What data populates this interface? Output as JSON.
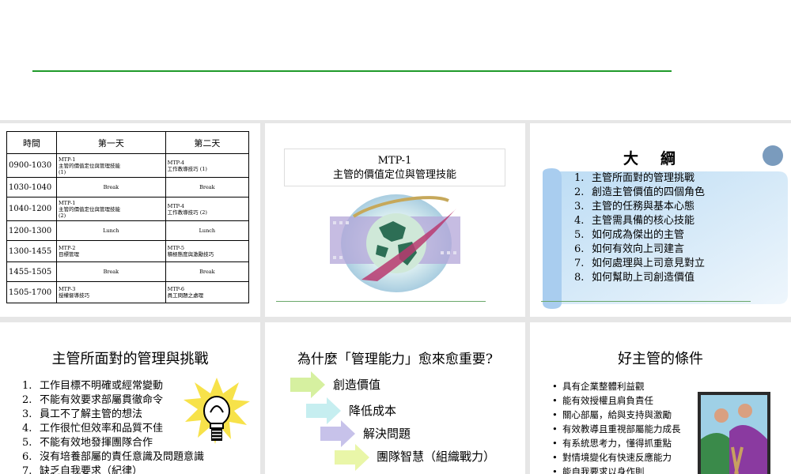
{
  "schedule": {
    "headers": [
      "時間",
      "第一天",
      "第二天"
    ],
    "rows": [
      {
        "time": "0900-1030",
        "day1": "MTP-1\n主管的價值定位與管理技能\n(1)",
        "day2": "MTP-4\n工作教導技巧 (1)"
      },
      {
        "time": "1030-1040",
        "day1": "Break",
        "day2": "Break"
      },
      {
        "time": "1040-1200",
        "day1": "MTP-1\n主管的價值定位與管理技能\n(2)",
        "day2": "MTP-4\n工作教導技巧 (2)"
      },
      {
        "time": "1200-1300",
        "day1": "Lunch",
        "day2": "Lunch"
      },
      {
        "time": "1300-1455",
        "day1": "MTP-2\n目標管理",
        "day2": "MTP-5\n積極態度與激勵技巧"
      },
      {
        "time": "1455-1505",
        "day1": "Break",
        "day2": "Break"
      },
      {
        "time": "1505-1700",
        "day1": "MTP-3\n授權督導技巧",
        "day2": "MTP-6\n員工問題之處理"
      }
    ]
  },
  "title_slide": {
    "line1": "MTP-1",
    "line2": "主管的價值定位與管理技能"
  },
  "outline": {
    "title": "大綱",
    "items": [
      "主管所面對的管理挑戰",
      "創造主管價值的四個角色",
      "主管的任務與基本心態",
      "主管需具備的核心技能",
      "如何成為傑出的主管",
      "如何有效向上司建言",
      "如何處理與上司意見對立",
      "如何幫助上司創造價值"
    ]
  },
  "challenges": {
    "title": "主管所面對的管理與挑戰",
    "items": [
      "工作目標不明確或經常變動",
      "不能有效要求部屬貫徹命令",
      "員工不了解主管的想法",
      "工作很忙但效率和品質不佳",
      "不能有效地發揮團隊合作",
      "沒有培養部屬的責任意識及問題意識",
      "缺乏自我要求（紀律）"
    ]
  },
  "why": {
    "title": "為什麼「管理能力」愈來愈重要?",
    "steps": [
      "創造價值",
      "降低成本",
      "解決問題",
      "團隊智慧（組織戰力）"
    ]
  },
  "good_boss": {
    "title": "好主管的條件",
    "items": [
      "具有企業整體利益觀",
      "能有效授權且肩負責任",
      "關心部屬，給與支持與激勵",
      "有效教導且重視部屬能力成長",
      "有系統思考力，懂得抓重點",
      "對情境變化有快速反應能力",
      "能自我要求以身作則"
    ]
  },
  "colors": {
    "rule_green": "#1f9a2a",
    "scroll_blue": "#cfe6f7",
    "arrow_green": "#d6f0a0",
    "arrow_purple": "#c7c2ea"
  }
}
